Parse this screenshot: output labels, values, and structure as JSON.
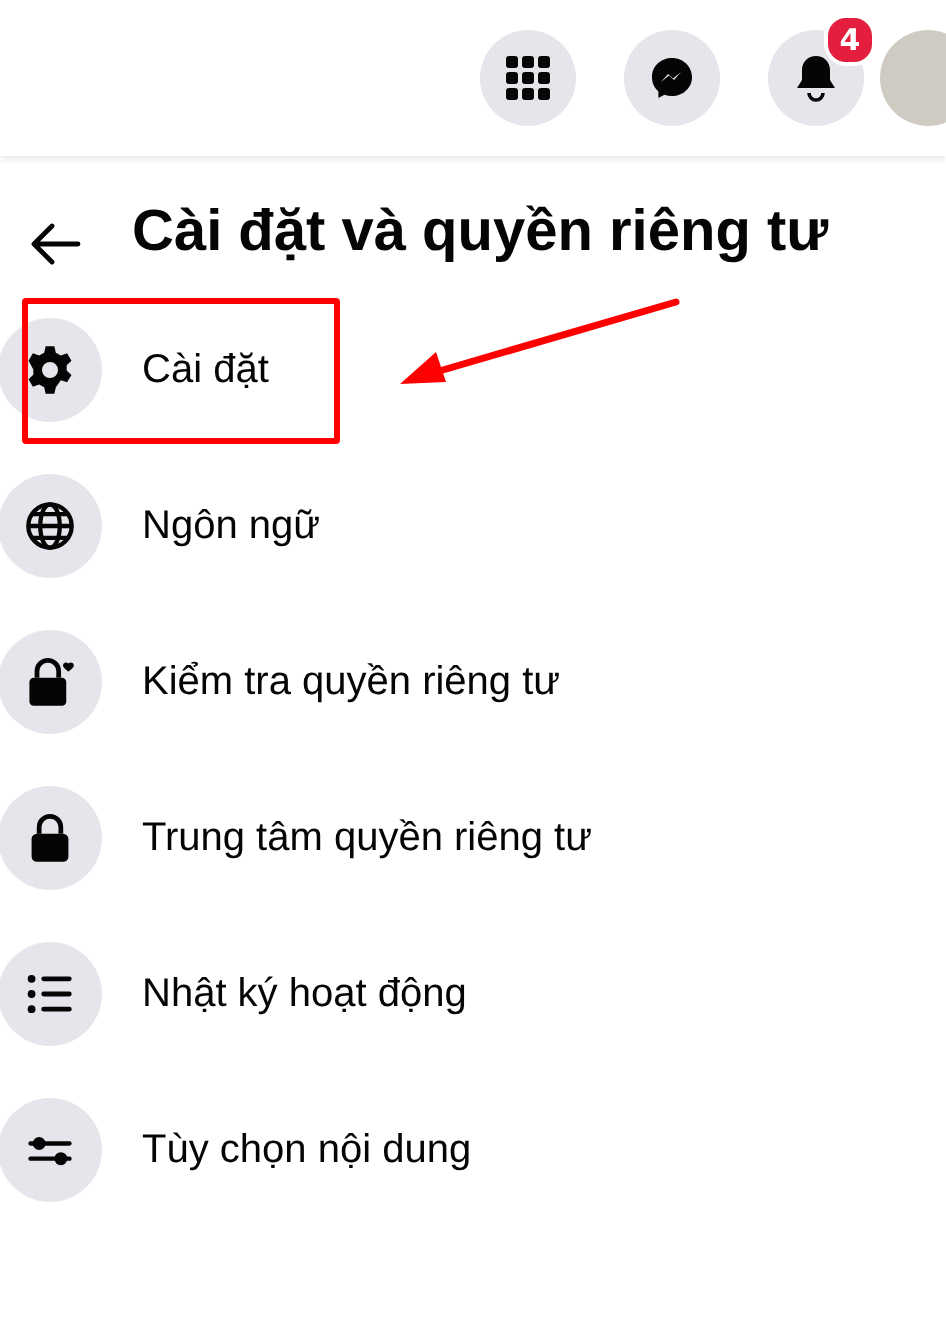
{
  "top_bar": {
    "buttons": [
      {
        "kind": "grid"
      },
      {
        "kind": "messenger"
      },
      {
        "kind": "bell",
        "badge": "4"
      }
    ]
  },
  "panel": {
    "title": "Cài đặt và quyền riêng tư",
    "items": [
      {
        "kind": "gear",
        "label": "Cài đặt",
        "highlighted": true
      },
      {
        "kind": "globe",
        "label": "Ngôn ngữ",
        "highlighted": false
      },
      {
        "kind": "lock-heart",
        "label": "Kiểm tra quyền riêng tư",
        "highlighted": false
      },
      {
        "kind": "lock",
        "label": "Trung tâm quyền riêng tư",
        "highlighted": false
      },
      {
        "kind": "list",
        "label": "Nhật ký hoạt động",
        "highlighted": false
      },
      {
        "kind": "sliders",
        "label": "Tùy chọn nội dung",
        "highlighted": false
      }
    ]
  }
}
